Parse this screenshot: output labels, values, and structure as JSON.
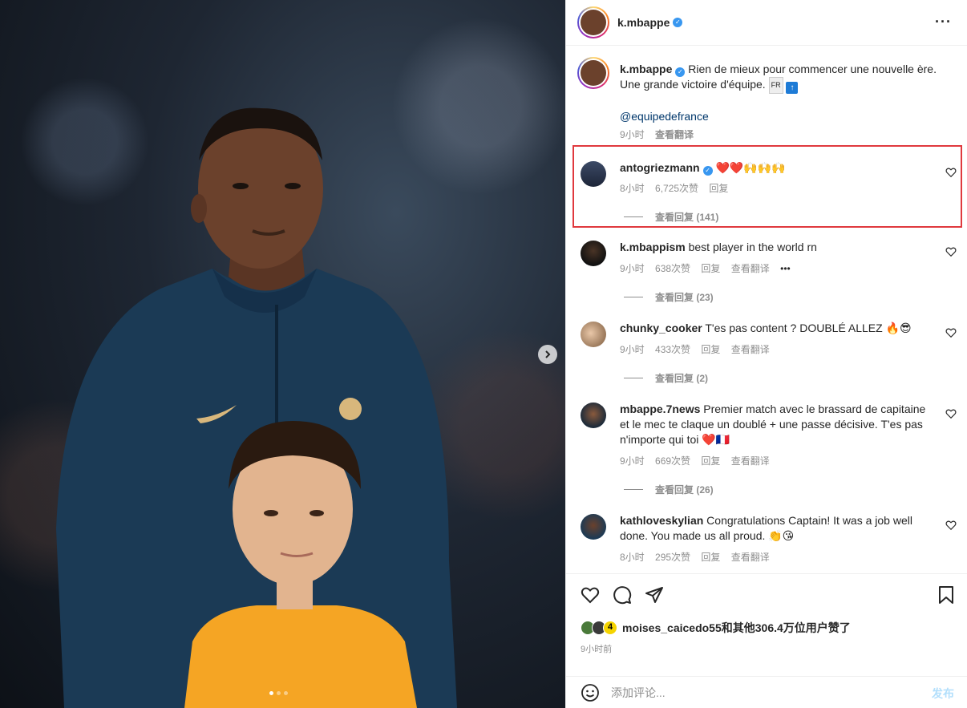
{
  "post": {
    "author": "k.mbappe",
    "verified_icon": "✓",
    "caption_text": "Rien de mieux pour commencer une nouvelle ère. Une grande victoire d'équipe.",
    "caption_flag": "FR",
    "caption_mention": "@equipedefrance",
    "caption_time": "9小时",
    "caption_translate": "查看翻译"
  },
  "comments": [
    {
      "username": "antogriezmann",
      "verified": true,
      "text": "❤️❤️🙌🙌🙌",
      "time": "8小时",
      "likes": "6,725次赞",
      "reply": "回复",
      "translate": "",
      "view_replies": "查看回复 (141)",
      "highlighted": true
    },
    {
      "username": "k.mbappism",
      "verified": false,
      "text": "best player in the world rn",
      "time": "9小时",
      "likes": "638次赞",
      "reply": "回复",
      "translate": "查看翻译",
      "more": "•••",
      "view_replies": "查看回复 (23)"
    },
    {
      "username": "chunky_cooker",
      "verified": false,
      "text": "T'es pas content ? DOUBLÉ ALLEZ 🔥😎",
      "time": "9小时",
      "likes": "433次赞",
      "reply": "回复",
      "translate": "查看翻译",
      "view_replies": "查看回复 (2)"
    },
    {
      "username": "mbappe.7news",
      "verified": false,
      "text": "Premier match avec le brassard de capitaine et le mec te claque un doublé + une passe décisive. T'es pas n'importe qui toi ❤️🇫🇷",
      "time": "9小时",
      "likes": "669次赞",
      "reply": "回复",
      "translate": "查看翻译",
      "view_replies": "查看回复 (26)"
    },
    {
      "username": "kathloveskylian",
      "verified": false,
      "text": "Congratulations Captain! It was a job well done. You made us all proud. 👏😘",
      "time": "8小时",
      "likes": "295次赞",
      "reply": "回复",
      "translate": "查看翻译",
      "view_replies": ""
    }
  ],
  "likes_summary": {
    "badge": "4",
    "text": "moises_caicedo55和其他306.4万位用户赞了"
  },
  "time_ago": "9小时前",
  "composer": {
    "placeholder": "添加评论...",
    "post_label": "发布"
  },
  "colors": {
    "highlight_border": "#e0393e",
    "link": "#00376b",
    "verified": "#3897f0",
    "post_button_disabled": "#b2dffc"
  },
  "icons": [
    "more-icon",
    "verified-icon",
    "heart-icon",
    "comment-icon",
    "share-icon",
    "bookmark-icon",
    "emoji-icon",
    "next-arrow-icon"
  ]
}
